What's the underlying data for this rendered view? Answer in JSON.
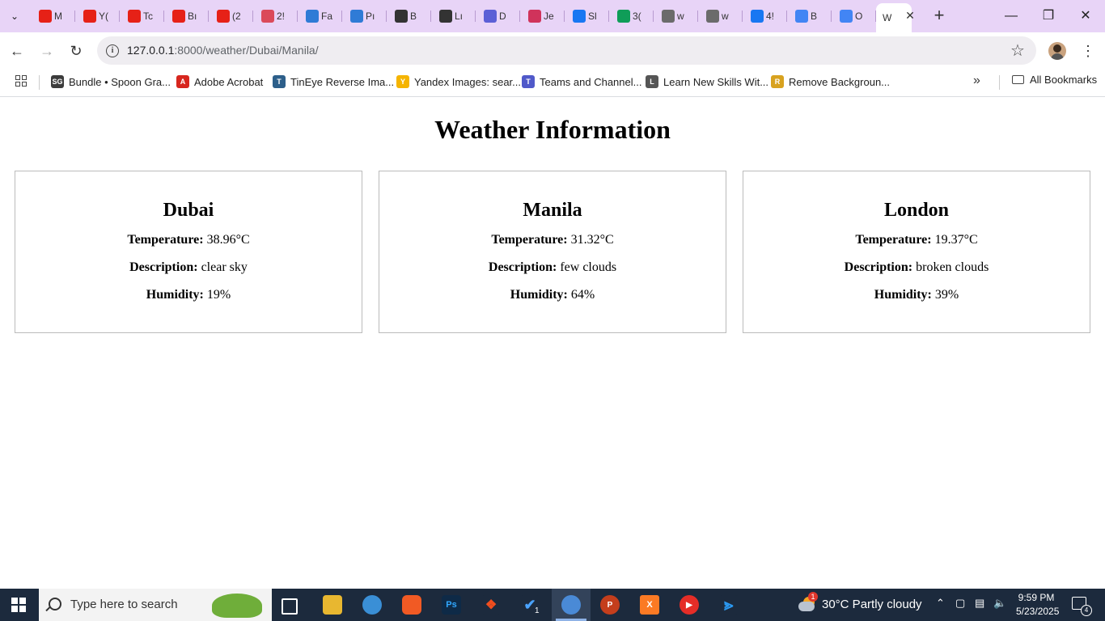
{
  "browser": {
    "tabs": [
      {
        "label": "M",
        "icon": "youtube-icon",
        "color": "#e62117"
      },
      {
        "label": "Y(",
        "icon": "youtube-icon",
        "color": "#e62117"
      },
      {
        "label": "Tc",
        "icon": "youtube-icon",
        "color": "#e62117"
      },
      {
        "label": "Bı",
        "icon": "youtube-icon",
        "color": "#e62117"
      },
      {
        "label": "(2",
        "icon": "youtube-icon",
        "color": "#e62117"
      },
      {
        "label": "2!",
        "icon": "check-circle-icon",
        "color": "#db4a5a"
      },
      {
        "label": "Fa",
        "icon": "flutter-icon",
        "color": "#2f7bd6"
      },
      {
        "label": "Pı",
        "icon": "flutter-icon",
        "color": "#2f7bd6"
      },
      {
        "label": "B",
        "icon": "openai-icon",
        "color": "#333333"
      },
      {
        "label": "Lı",
        "icon": "openai-icon",
        "color": "#333333"
      },
      {
        "label": "D",
        "icon": "bird-icon",
        "color": "#5b5fd6"
      },
      {
        "label": "Je",
        "icon": "arc-icon",
        "color": "#d0335b"
      },
      {
        "label": "Sl",
        "icon": "messenger-icon",
        "color": "#1877f2"
      },
      {
        "label": "3(",
        "icon": "sheets-icon",
        "color": "#0f9d58"
      },
      {
        "label": "w",
        "icon": "github-icon",
        "color": "#6b6b6b"
      },
      {
        "label": "w",
        "icon": "github-icon",
        "color": "#6b6b6b"
      },
      {
        "label": "4!",
        "icon": "facebook-icon",
        "color": "#1877f2"
      },
      {
        "label": "B",
        "icon": "google-icon",
        "color": "#4285f4"
      },
      {
        "label": "O",
        "icon": "google-icon",
        "color": "#4285f4"
      },
      {
        "label": "W",
        "icon": "page-icon",
        "color": "#ffffff",
        "active": true
      }
    ],
    "url_host": "127.0.0.1",
    "url_path": ":8000/weather/Dubai/Manila/",
    "bookmarks": [
      {
        "label": "Bundle • Spoon Gra...",
        "icon": "sg-icon",
        "color": "#3c3c3c",
        "mark": "SG"
      },
      {
        "label": "Adobe Acrobat",
        "icon": "acrobat-icon",
        "color": "#d7261e",
        "mark": "A"
      },
      {
        "label": "TinEye Reverse Ima...",
        "icon": "tineye-icon",
        "color": "#2d5f8a",
        "mark": "T"
      },
      {
        "label": "Yandex Images: sear...",
        "icon": "yandex-icon",
        "color": "#f5b400",
        "mark": "Y"
      },
      {
        "label": "Teams and Channel...",
        "icon": "teams-icon",
        "color": "#5059c9",
        "mark": "T"
      },
      {
        "label": "Learn New Skills Wit...",
        "icon": "skills-icon",
        "color": "#555555",
        "mark": "L"
      },
      {
        "label": "Remove Backgroun...",
        "icon": "removebg-icon",
        "color": "#d8a21f",
        "mark": "R"
      }
    ],
    "all_bookmarks": "All Bookmarks"
  },
  "page": {
    "title": "Weather Information",
    "labels": {
      "temperature": "Temperature:",
      "description": "Description:",
      "humidity": "Humidity:"
    },
    "cities": [
      {
        "name": "Dubai",
        "temperature": "38.96°C",
        "description": "clear sky",
        "humidity": "19%"
      },
      {
        "name": "Manila",
        "temperature": "31.32°C",
        "description": "few clouds",
        "humidity": "64%"
      },
      {
        "name": "London",
        "temperature": "19.37°C",
        "description": "broken clouds",
        "humidity": "39%"
      }
    ]
  },
  "taskbar": {
    "search_placeholder": "Type here to search",
    "weather_badge": "1",
    "weather": "30°C  Partly cloudy",
    "time": "9:59 PM",
    "date": "5/23/2025",
    "notification_count": "4",
    "vscode_badge": "1"
  }
}
